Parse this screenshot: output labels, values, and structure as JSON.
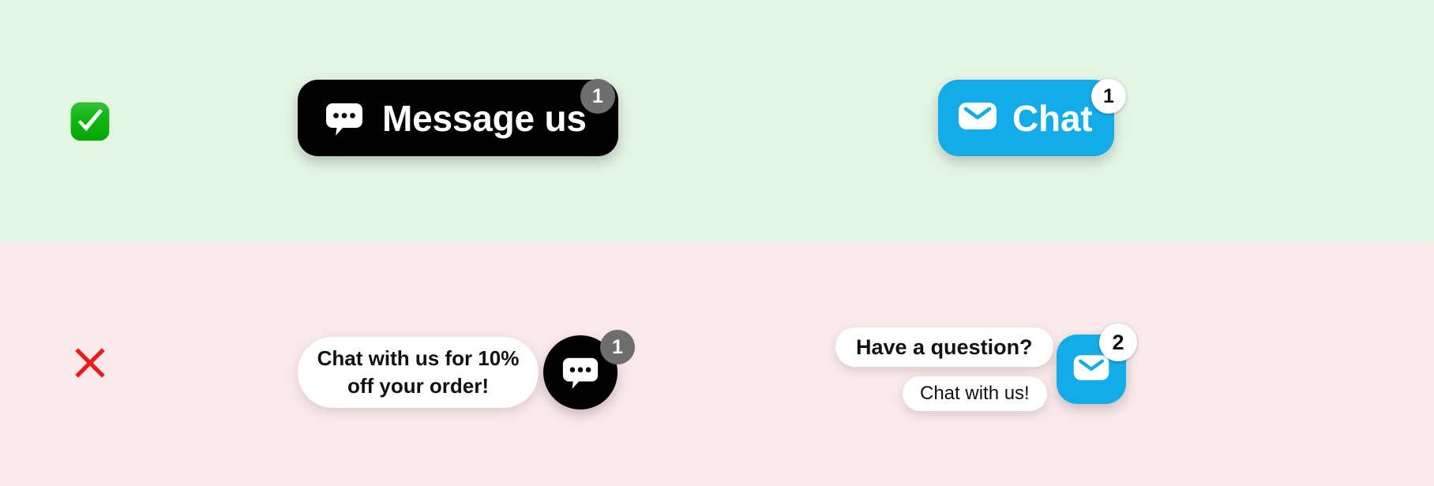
{
  "page": {
    "rows": [
      {
        "id": "recommended",
        "status_icon": "white-heavy-check-mark-icon",
        "background_color": "#e4f5e4"
      },
      {
        "id": "not-recommended",
        "status_icon": "cross-mark-icon",
        "background_color": "#fae9ea"
      }
    ]
  },
  "good_examples": {
    "message_button": {
      "label": "Message us",
      "icon": "chat-bubble-dots-icon",
      "badge_count": "1",
      "background_color": "#000000",
      "text_color": "#ffffff",
      "badge_color": "#6e6e6e"
    },
    "chat_button": {
      "label": "Chat",
      "icon": "envelope-icon",
      "badge_count": "1",
      "background_color": "#14ace8",
      "text_color": "#ffffff",
      "badge_color": "#ffffff"
    }
  },
  "bad_examples": {
    "promo_launcher": {
      "message": "Chat with us for 10% off your order!",
      "icon": "chat-bubble-dots-icon",
      "badge_count": "1",
      "launcher_color": "#000000",
      "bubble_color": "#ffffff",
      "badge_color": "#6e6e6e"
    },
    "question_launcher": {
      "message_primary": "Have a question?",
      "message_secondary": "Chat with us!",
      "icon": "envelope-icon",
      "badge_count": "2",
      "launcher_color": "#14ace8",
      "bubble_color": "#ffffff",
      "badge_color": "#ffffff"
    }
  }
}
